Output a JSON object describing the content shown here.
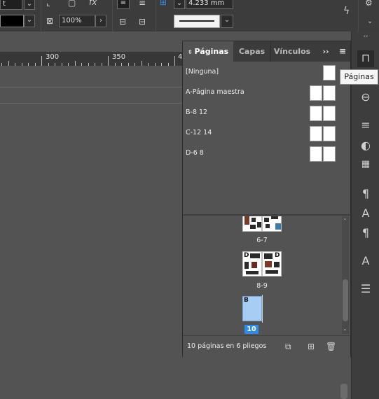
{
  "toolbar": {
    "stroke_weight": "4.233 mm",
    "zoom_percent": "100%",
    "effects_icon": "fx-icon",
    "lightning_icon": "lightning-icon",
    "gear_icon": "gear-icon"
  },
  "ruler": {
    "labels": [
      "300",
      "350",
      "4"
    ]
  },
  "panel": {
    "tabs": [
      {
        "label": "Páginas"
      },
      {
        "label": "Capas"
      },
      {
        "label": "Vínculos"
      }
    ],
    "overflow_label": "››",
    "masters": [
      {
        "label": "[Ninguna]"
      },
      {
        "label": "A-Página maestra"
      },
      {
        "label": "B-8 12"
      },
      {
        "label": "C-12 14"
      },
      {
        "label": "D-6 8"
      }
    ],
    "spreads": [
      {
        "label": "6-7"
      },
      {
        "label": "8-9",
        "left_master": "D",
        "right_master": "D"
      },
      {
        "label": "10",
        "master": "B"
      }
    ],
    "footer_text": "10 páginas en 6 pliegos"
  },
  "tooltip": {
    "text": "Páginas"
  },
  "colors": {
    "accent": "#2d8ceb",
    "selected_page": "#a8cdf5",
    "panel_bg": "#535353"
  }
}
